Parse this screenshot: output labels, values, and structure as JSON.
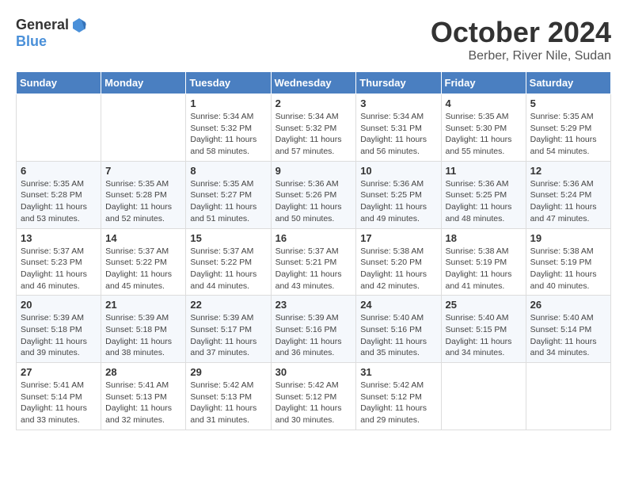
{
  "header": {
    "logo_general": "General",
    "logo_blue": "Blue",
    "month": "October 2024",
    "location": "Berber, River Nile, Sudan"
  },
  "days_of_week": [
    "Sunday",
    "Monday",
    "Tuesday",
    "Wednesday",
    "Thursday",
    "Friday",
    "Saturday"
  ],
  "weeks": [
    [
      {
        "day": "",
        "info": ""
      },
      {
        "day": "",
        "info": ""
      },
      {
        "day": "1",
        "info": "Sunrise: 5:34 AM\nSunset: 5:32 PM\nDaylight: 11 hours and 58 minutes."
      },
      {
        "day": "2",
        "info": "Sunrise: 5:34 AM\nSunset: 5:32 PM\nDaylight: 11 hours and 57 minutes."
      },
      {
        "day": "3",
        "info": "Sunrise: 5:34 AM\nSunset: 5:31 PM\nDaylight: 11 hours and 56 minutes."
      },
      {
        "day": "4",
        "info": "Sunrise: 5:35 AM\nSunset: 5:30 PM\nDaylight: 11 hours and 55 minutes."
      },
      {
        "day": "5",
        "info": "Sunrise: 5:35 AM\nSunset: 5:29 PM\nDaylight: 11 hours and 54 minutes."
      }
    ],
    [
      {
        "day": "6",
        "info": "Sunrise: 5:35 AM\nSunset: 5:28 PM\nDaylight: 11 hours and 53 minutes."
      },
      {
        "day": "7",
        "info": "Sunrise: 5:35 AM\nSunset: 5:28 PM\nDaylight: 11 hours and 52 minutes."
      },
      {
        "day": "8",
        "info": "Sunrise: 5:35 AM\nSunset: 5:27 PM\nDaylight: 11 hours and 51 minutes."
      },
      {
        "day": "9",
        "info": "Sunrise: 5:36 AM\nSunset: 5:26 PM\nDaylight: 11 hours and 50 minutes."
      },
      {
        "day": "10",
        "info": "Sunrise: 5:36 AM\nSunset: 5:25 PM\nDaylight: 11 hours and 49 minutes."
      },
      {
        "day": "11",
        "info": "Sunrise: 5:36 AM\nSunset: 5:25 PM\nDaylight: 11 hours and 48 minutes."
      },
      {
        "day": "12",
        "info": "Sunrise: 5:36 AM\nSunset: 5:24 PM\nDaylight: 11 hours and 47 minutes."
      }
    ],
    [
      {
        "day": "13",
        "info": "Sunrise: 5:37 AM\nSunset: 5:23 PM\nDaylight: 11 hours and 46 minutes."
      },
      {
        "day": "14",
        "info": "Sunrise: 5:37 AM\nSunset: 5:22 PM\nDaylight: 11 hours and 45 minutes."
      },
      {
        "day": "15",
        "info": "Sunrise: 5:37 AM\nSunset: 5:22 PM\nDaylight: 11 hours and 44 minutes."
      },
      {
        "day": "16",
        "info": "Sunrise: 5:37 AM\nSunset: 5:21 PM\nDaylight: 11 hours and 43 minutes."
      },
      {
        "day": "17",
        "info": "Sunrise: 5:38 AM\nSunset: 5:20 PM\nDaylight: 11 hours and 42 minutes."
      },
      {
        "day": "18",
        "info": "Sunrise: 5:38 AM\nSunset: 5:19 PM\nDaylight: 11 hours and 41 minutes."
      },
      {
        "day": "19",
        "info": "Sunrise: 5:38 AM\nSunset: 5:19 PM\nDaylight: 11 hours and 40 minutes."
      }
    ],
    [
      {
        "day": "20",
        "info": "Sunrise: 5:39 AM\nSunset: 5:18 PM\nDaylight: 11 hours and 39 minutes."
      },
      {
        "day": "21",
        "info": "Sunrise: 5:39 AM\nSunset: 5:18 PM\nDaylight: 11 hours and 38 minutes."
      },
      {
        "day": "22",
        "info": "Sunrise: 5:39 AM\nSunset: 5:17 PM\nDaylight: 11 hours and 37 minutes."
      },
      {
        "day": "23",
        "info": "Sunrise: 5:39 AM\nSunset: 5:16 PM\nDaylight: 11 hours and 36 minutes."
      },
      {
        "day": "24",
        "info": "Sunrise: 5:40 AM\nSunset: 5:16 PM\nDaylight: 11 hours and 35 minutes."
      },
      {
        "day": "25",
        "info": "Sunrise: 5:40 AM\nSunset: 5:15 PM\nDaylight: 11 hours and 34 minutes."
      },
      {
        "day": "26",
        "info": "Sunrise: 5:40 AM\nSunset: 5:14 PM\nDaylight: 11 hours and 34 minutes."
      }
    ],
    [
      {
        "day": "27",
        "info": "Sunrise: 5:41 AM\nSunset: 5:14 PM\nDaylight: 11 hours and 33 minutes."
      },
      {
        "day": "28",
        "info": "Sunrise: 5:41 AM\nSunset: 5:13 PM\nDaylight: 11 hours and 32 minutes."
      },
      {
        "day": "29",
        "info": "Sunrise: 5:42 AM\nSunset: 5:13 PM\nDaylight: 11 hours and 31 minutes."
      },
      {
        "day": "30",
        "info": "Sunrise: 5:42 AM\nSunset: 5:12 PM\nDaylight: 11 hours and 30 minutes."
      },
      {
        "day": "31",
        "info": "Sunrise: 5:42 AM\nSunset: 5:12 PM\nDaylight: 11 hours and 29 minutes."
      },
      {
        "day": "",
        "info": ""
      },
      {
        "day": "",
        "info": ""
      }
    ]
  ]
}
